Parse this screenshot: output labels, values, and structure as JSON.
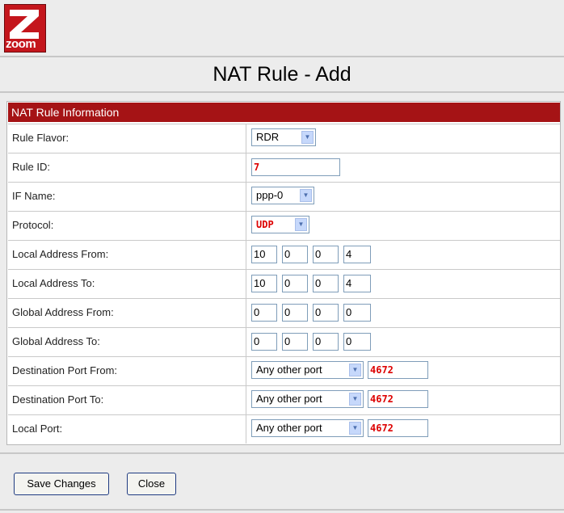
{
  "logo": {
    "text": "zoom",
    "icon": "zoom-z-logo"
  },
  "page": {
    "title": "NAT Rule - Add"
  },
  "section": {
    "header": "NAT Rule Information"
  },
  "form": {
    "rule_flavor": {
      "label": "Rule Flavor:",
      "value": "RDR"
    },
    "rule_id": {
      "label": "Rule ID:",
      "value": "7"
    },
    "if_name": {
      "label": "IF Name:",
      "value": "ppp-0"
    },
    "protocol": {
      "label": "Protocol:",
      "value": "UDP"
    },
    "local_address_from": {
      "label": "Local Address From:",
      "octets": [
        "10",
        "0",
        "0",
        "4"
      ]
    },
    "local_address_to": {
      "label": "Local Address To:",
      "octets": [
        "10",
        "0",
        "0",
        "4"
      ]
    },
    "global_address_from": {
      "label": "Global Address From:",
      "octets": [
        "0",
        "0",
        "0",
        "0"
      ]
    },
    "global_address_to": {
      "label": "Global Address To:",
      "octets": [
        "0",
        "0",
        "0",
        "0"
      ]
    },
    "destination_port_from": {
      "label": "Destination Port From:",
      "select": "Any other port",
      "port": "4672"
    },
    "destination_port_to": {
      "label": "Destination Port To:",
      "select": "Any other port",
      "port": "4672"
    },
    "local_port": {
      "label": "Local Port:",
      "select": "Any other port",
      "port": "4672"
    }
  },
  "buttons": {
    "save": "Save Changes",
    "close": "Close"
  },
  "colors": {
    "header_bg": "#a51315",
    "accent_red": "#d00000",
    "logo_red": "#c4161c"
  }
}
